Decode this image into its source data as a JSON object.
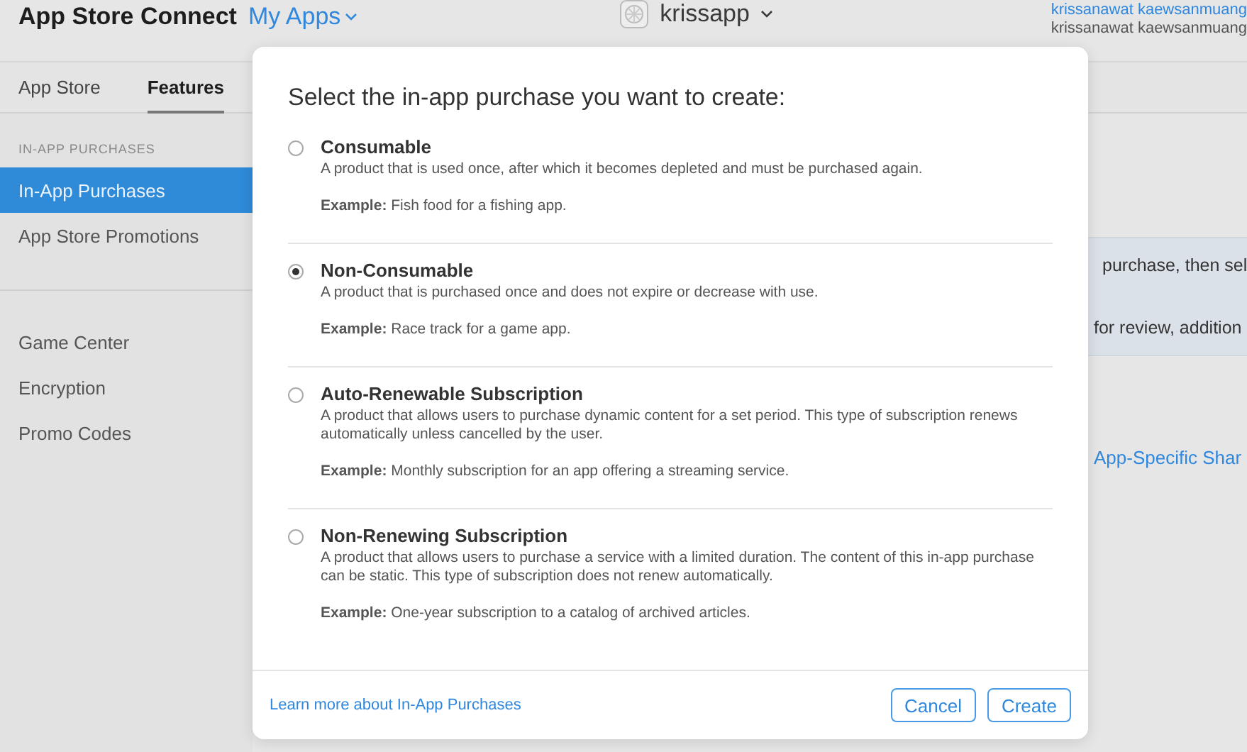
{
  "header": {
    "brand": "App Store Connect",
    "menu": "My Apps",
    "app_name": "krissapp",
    "user_name": "krissanawat kaewsanmuang",
    "user_team": "krissanawat kaewsanmuang"
  },
  "tabs": [
    {
      "label": "App Store",
      "selected": false
    },
    {
      "label": "Features",
      "selected": true
    }
  ],
  "sidebar": {
    "section": "IN-APP PURCHASES",
    "groups": [
      [
        {
          "label": "In-App Purchases",
          "selected": true
        },
        {
          "label": "App Store Promotions",
          "selected": false
        }
      ],
      [
        {
          "label": "Game Center",
          "selected": false
        },
        {
          "label": "Encryption",
          "selected": false
        },
        {
          "label": "Promo Codes",
          "selected": false
        }
      ]
    ]
  },
  "background": {
    "info_lines": [
      "purchase, then sel",
      "for review, addition"
    ],
    "link": "App-Specific Shar"
  },
  "dialog": {
    "title": "Select the in-app purchase you want to create:",
    "options": [
      {
        "name": "Consumable",
        "description": "A product that is used once, after which it becomes depleted and must be purchased again.",
        "example_label": "Example:",
        "example": "Fish food for a fishing app.",
        "selected": false
      },
      {
        "name": "Non-Consumable",
        "description": "A product that is purchased once and does not expire or decrease with use.",
        "example_label": "Example:",
        "example": "Race track for a game app.",
        "selected": true
      },
      {
        "name": "Auto-Renewable Subscription",
        "description": "A product that allows users to purchase dynamic content for a set period. This type of subscription renews automatically unless cancelled by the user.",
        "example_label": "Example:",
        "example": "Monthly subscription for an app offering a streaming service.",
        "selected": false
      },
      {
        "name": "Non-Renewing Subscription",
        "description": "A product that allows users to purchase a service with a limited duration. The content of this in-app purchase can be static. This type of subscription does not renew automatically.",
        "example_label": "Example:",
        "example": "One-year subscription to a catalog of archived articles.",
        "selected": false
      }
    ],
    "learn_more": "Learn more about In-App Purchases",
    "buttons": [
      "Cancel",
      "Create"
    ]
  }
}
